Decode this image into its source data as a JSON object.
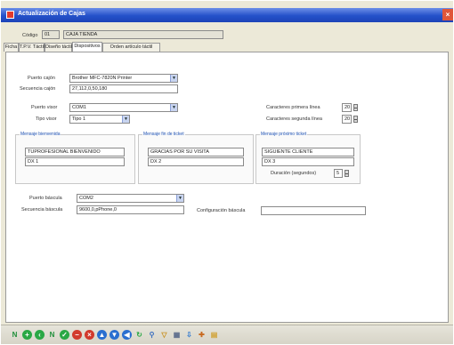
{
  "window": {
    "title": "Actualización de Cajas"
  },
  "header": {
    "code_label": "Código",
    "code_value": "01",
    "name_value": "CAJA TIENDA"
  },
  "tabs": [
    {
      "label": "Ficha"
    },
    {
      "label": "T.P.V. Táctil"
    },
    {
      "label": "Diseño táctil"
    },
    {
      "label": "Dispositivos"
    },
    {
      "label": "Orden artículo táctil"
    }
  ],
  "printer": {
    "port_label": "Puerto cajón",
    "port_value": "Brother MFC-7820N Printer",
    "seq_label": "Secuencia cajón",
    "seq_value": "27,112,0,50,180"
  },
  "visor": {
    "port_label": "Puerto visor",
    "port_value": "COM1",
    "type_label": "Tipo visor",
    "type_value": "Tipo 1",
    "chars_line1_label": "Caracteres primera línea",
    "chars_line1_value": "20",
    "chars_line2_label": "Caracteres segunda línea",
    "chars_line2_value": "20"
  },
  "messages": {
    "welcome": {
      "title": "Mensaje bienvenida",
      "line1": "TUPROFESIONAL BIENVENIDO",
      "line2": "DX 1"
    },
    "end_sale": {
      "title": "Mensaje fin de ticket",
      "line1": "GRACIAS POR SU VISITA",
      "line2": "DX 2"
    },
    "next_client": {
      "title": "Mensaje próximo ticket",
      "line1": "SIGUIENTE CLIENTE",
      "line2": "DX 3"
    },
    "duration_label": "Duración (segundos)",
    "duration_value": "5"
  },
  "scale": {
    "port_label": "Puerto báscula",
    "port_value": "COM2",
    "seq_label": "Secuencia báscula",
    "seq_value": "9600,0,pPhone,0",
    "config_label": "Configuración báscula",
    "config_value": ""
  },
  "toolbar": {
    "icons": [
      {
        "name": "first-record-icon",
        "glyph": "N",
        "color": "#1f8f3a",
        "shape": "text"
      },
      {
        "name": "new-record-icon",
        "glyph": "+",
        "color": "#2aa845",
        "shape": "circle"
      },
      {
        "name": "previous-record-icon",
        "glyph": "‹",
        "color": "#2aa845",
        "shape": "circle"
      },
      {
        "name": "next-record-icon",
        "glyph": "N",
        "color": "#1f8f3a",
        "shape": "text"
      },
      {
        "name": "save-icon",
        "glyph": "✓",
        "color": "#2aa845",
        "shape": "circle"
      },
      {
        "name": "delete-icon",
        "glyph": "−",
        "color": "#d23a2c",
        "shape": "circle"
      },
      {
        "name": "cancel-icon",
        "glyph": "×",
        "color": "#d23a2c",
        "shape": "circle"
      },
      {
        "name": "up-icon",
        "glyph": "▲",
        "color": "#2a6fd0",
        "shape": "circle"
      },
      {
        "name": "down-icon",
        "glyph": "▼",
        "color": "#2a6fd0",
        "shape": "circle"
      },
      {
        "name": "back-icon",
        "glyph": "◀",
        "color": "#2a6fd0",
        "shape": "circle"
      },
      {
        "name": "refresh-icon",
        "glyph": "↻",
        "color": "#2aa845",
        "shape": "text"
      },
      {
        "name": "search-icon",
        "glyph": "⚲",
        "color": "#3a6fc0",
        "shape": "text"
      },
      {
        "name": "filter-icon",
        "glyph": "▽",
        "color": "#c89020",
        "shape": "text"
      },
      {
        "name": "print-icon",
        "glyph": "▦",
        "color": "#5a6a8a",
        "shape": "text"
      },
      {
        "name": "export-icon",
        "glyph": "⇩",
        "color": "#3a7fd0",
        "shape": "text"
      },
      {
        "name": "tools-icon",
        "glyph": "✚",
        "color": "#c86a20",
        "shape": "text"
      },
      {
        "name": "folder-icon",
        "glyph": "▤",
        "color": "#d0a030",
        "shape": "text"
      }
    ]
  }
}
